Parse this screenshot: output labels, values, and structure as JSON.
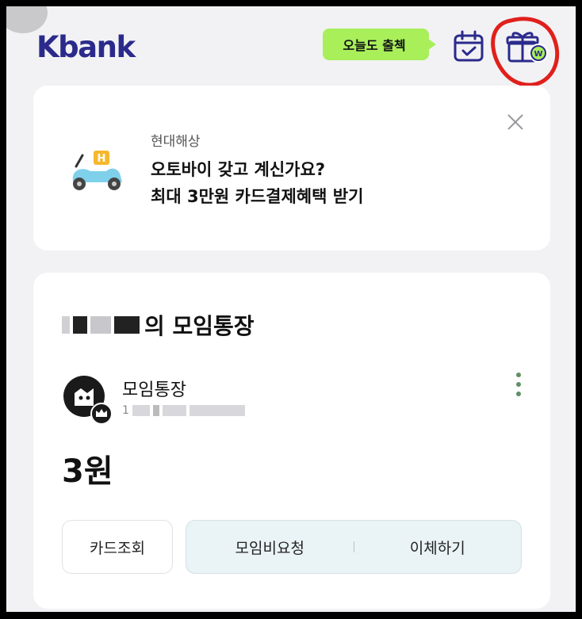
{
  "header": {
    "logo": "Kbank",
    "checkin_label": "오늘도 출첵",
    "calendar_icon": "calendar-check-icon",
    "gift_icon": "gift-box-icon"
  },
  "promo": {
    "subtitle": "현대해상",
    "line1": "오토바이 갖고 계신가요?",
    "line2": "최대 3만원 카드결제혜택 받기",
    "image_icon": "scooter-icon",
    "close_icon": "close-icon"
  },
  "account": {
    "title_suffix": "의 모임통장",
    "type": "모임통장",
    "number_prefix": "1",
    "balance": "3원",
    "menu_icon": "more-vertical-icon",
    "buttons": {
      "card": "카드조회",
      "request": "모임비요청",
      "transfer": "이체하기"
    }
  },
  "colors": {
    "brand": "#2b2a8c",
    "checkin": "#a8ef5a",
    "annotation": "#e0201c"
  }
}
